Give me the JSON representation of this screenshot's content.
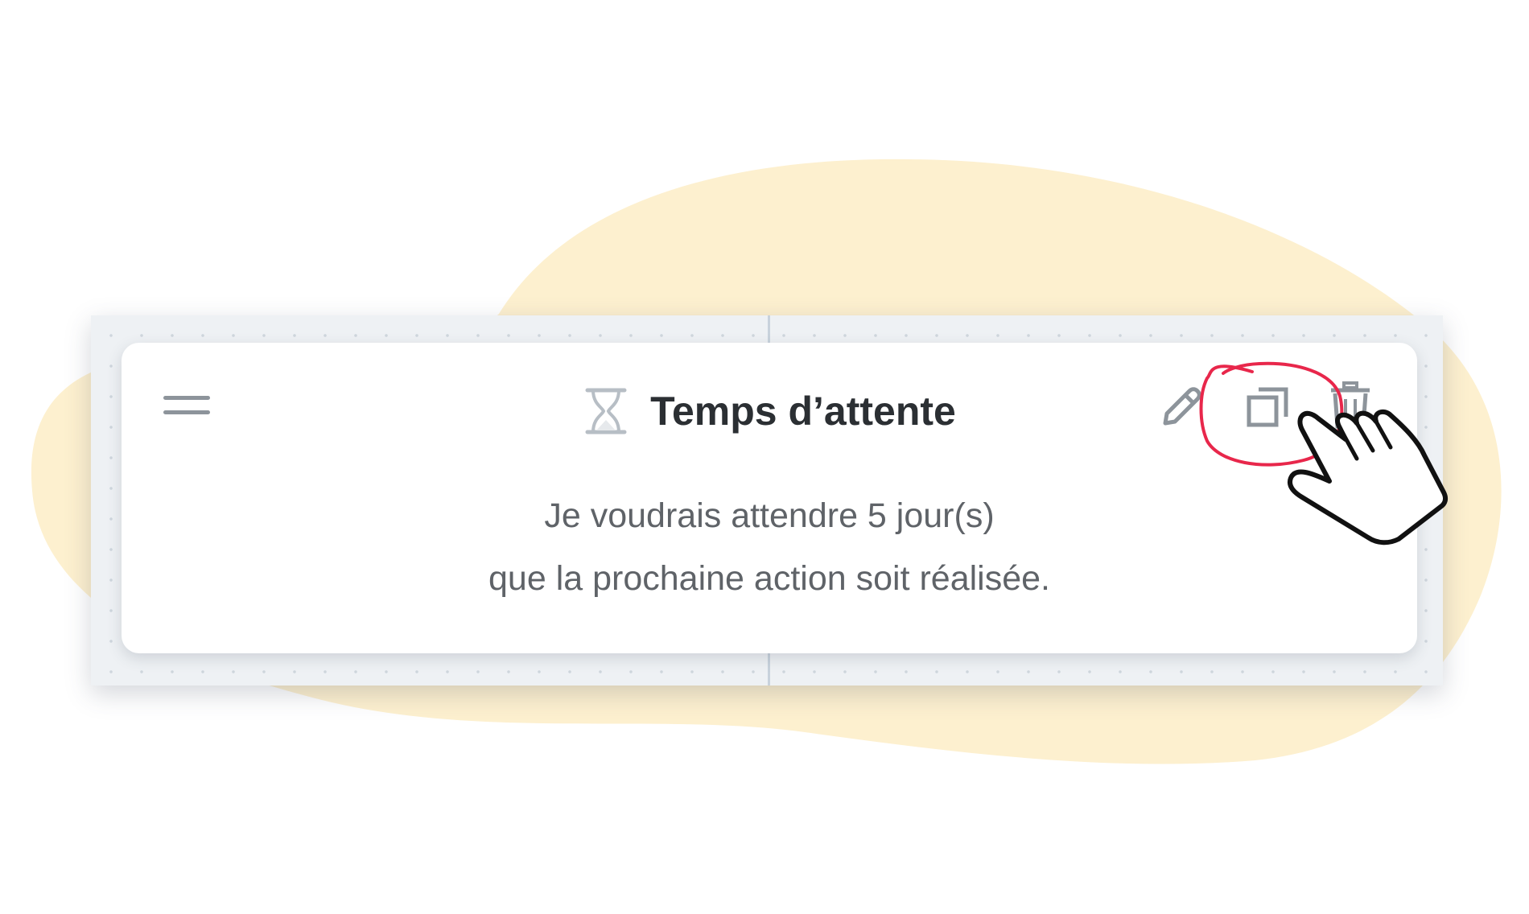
{
  "card": {
    "title": "Temps d’attente",
    "description_line1": "Je voudrais attendre 5 jour(s)",
    "description_line2": "que la prochaine action soit réalisée."
  },
  "icons": {
    "drag": "drag-handle-icon",
    "type": "hourglass-icon",
    "edit": "pencil-icon",
    "duplicate": "copy-icon",
    "delete": "trash-icon",
    "cursor": "pointing-hand-icon"
  },
  "colors": {
    "blob": "#fdf0cf",
    "highlight": "#e8274b",
    "title": "#2b2f33",
    "text": "#5f6368",
    "icon": "#8d949b"
  }
}
